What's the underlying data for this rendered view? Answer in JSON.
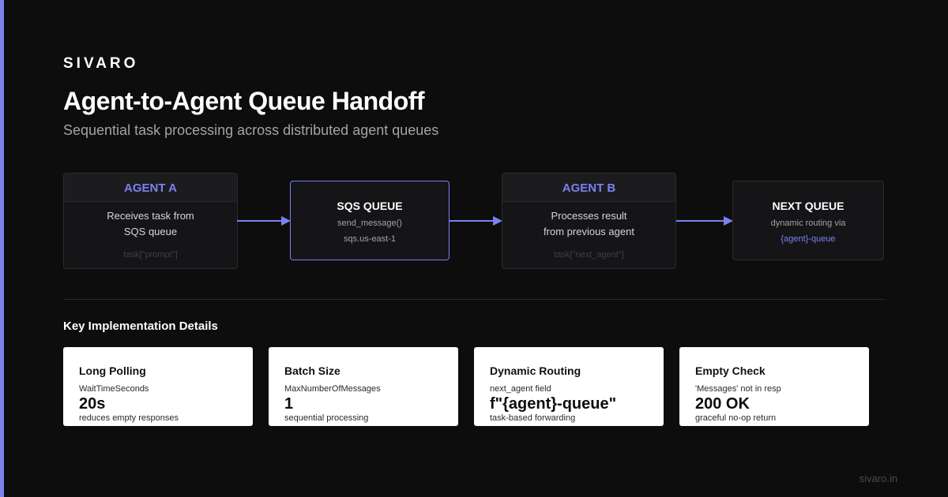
{
  "brand": "SIVARO",
  "title": "Agent-to-Agent Queue Handoff",
  "subtitle": "Sequential task processing across distributed agent queues",
  "flow": {
    "agent_a": {
      "label": "AGENT A",
      "line1": "Receives task from",
      "line2": "SQS queue",
      "code": "task[\"prompt\"]"
    },
    "sqs_queue": {
      "label": "SQS QUEUE",
      "line1": "send_message()",
      "line2": "sqs.us-east-1"
    },
    "agent_b": {
      "label": "AGENT B",
      "line1": "Processes result",
      "line2": "from previous agent",
      "code": "task[\"next_agent\"]"
    },
    "next_queue": {
      "label": "NEXT QUEUE",
      "line1": "dynamic routing via",
      "line2": "{agent}-queue"
    }
  },
  "details": {
    "heading": "Key Implementation Details",
    "cards": [
      {
        "title": "Long Polling",
        "label": "WaitTimeSeconds",
        "value": "20s",
        "note": "reduces empty responses"
      },
      {
        "title": "Batch Size",
        "label": "MaxNumberOfMessages",
        "value": "1",
        "note": "sequential processing"
      },
      {
        "title": "Dynamic Routing",
        "label": "next_agent field",
        "value": "f\"{agent}-queue\"",
        "note": "task-based forwarding"
      },
      {
        "title": "Empty Check",
        "label": "'Messages' not in resp",
        "value": "200 OK",
        "note": "graceful no-op return"
      }
    ]
  },
  "footer": {
    "url": "sivaro.in"
  },
  "colors": {
    "background": "#0d0d0e",
    "accent": "#7b80f0",
    "card_background": "#ffffff",
    "node_background": "#151518"
  }
}
